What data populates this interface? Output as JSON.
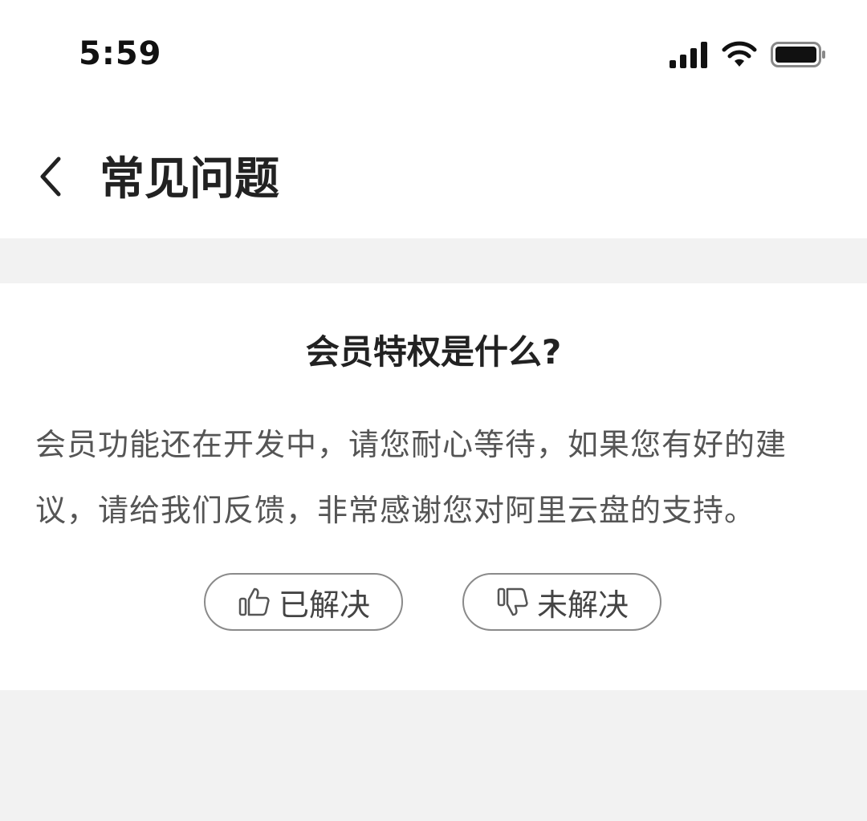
{
  "status_bar": {
    "time": "5:59",
    "icons": [
      "cellular-signal-icon",
      "wifi-icon",
      "battery-icon"
    ]
  },
  "nav": {
    "back_icon": "chevron-left-icon",
    "title": "常见问题"
  },
  "faq": {
    "question": "会员特权是什么?",
    "answer": "会员功能还在开发中，请您耐心等待，如果您有好的建议，请给我们反馈，非常感谢您对阿里云盘的支持。"
  },
  "feedback": {
    "resolved": {
      "label": "已解决",
      "icon": "thumbs-up-icon"
    },
    "unresolved": {
      "label": "未解决",
      "icon": "thumbs-down-icon"
    }
  },
  "colors": {
    "page_background": "#f2f2f2",
    "card_background": "#ffffff",
    "button_border": "#8a8a8a",
    "title_text": "#222222",
    "body_text": "#555555"
  }
}
